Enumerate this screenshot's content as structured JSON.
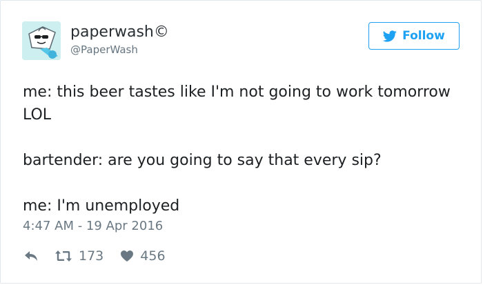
{
  "tweet": {
    "author": {
      "display_name": "paperwash",
      "badge": "©",
      "handle": "@PaperWash",
      "avatar_icon": "tissue-box-avatar-icon"
    },
    "follow_button": {
      "label": "Follow",
      "icon": "twitter-bird-icon"
    },
    "text_lines": [
      "me: this beer tastes like I'm not going to work tomorrow LOL",
      "bartender: are you going to say that every sip?",
      "me: I'm unemployed"
    ],
    "timestamp": "4:47 AM - 19 Apr 2016",
    "actions": {
      "reply_icon": "reply-icon",
      "retweet_icon": "retweet-icon",
      "retweet_count": "173",
      "like_icon": "heart-icon",
      "like_count": "456"
    }
  },
  "colors": {
    "twitter_blue": "#1da1f2",
    "text": "#1c2022",
    "muted": "#697882",
    "border": "#e1e8ed",
    "avatar_bg": "#cdeff0"
  }
}
